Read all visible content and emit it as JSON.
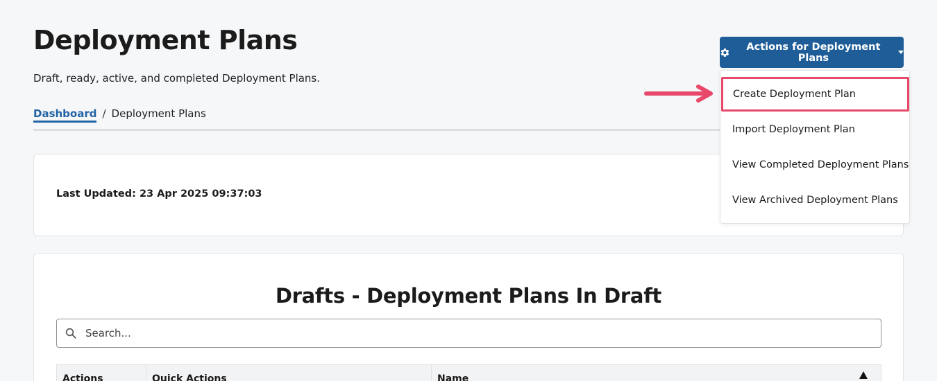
{
  "header": {
    "title": "Deployment Plans",
    "subtitle": "Draft, ready, active, and completed Deployment Plans."
  },
  "breadcrumb": {
    "link_label": "Dashboard",
    "separator": "/",
    "current": "Deployment Plans"
  },
  "actions_menu": {
    "button_label": "Actions for Deployment Plans",
    "button_icon": "gear-icon",
    "items": [
      {
        "label": "Create Deployment Plan",
        "highlighted": true
      },
      {
        "label": "Import Deployment Plan",
        "highlighted": false
      },
      {
        "label": "View Completed Deployment Plans",
        "highlighted": false
      },
      {
        "label": "View Archived Deployment Plans",
        "highlighted": false
      }
    ]
  },
  "status": {
    "last_updated": "Last Updated: 23 Apr 2025 09:37:03"
  },
  "drafts": {
    "title": "Drafts - Deployment Plans In Draft",
    "search_placeholder": "Search...",
    "search_value": "",
    "columns": [
      "Actions",
      "Quick Actions",
      "Name"
    ]
  },
  "colors": {
    "primary": "#1f5d98",
    "link": "#2163a5",
    "highlight": "#e8496a",
    "background": "#f6f7f9"
  }
}
